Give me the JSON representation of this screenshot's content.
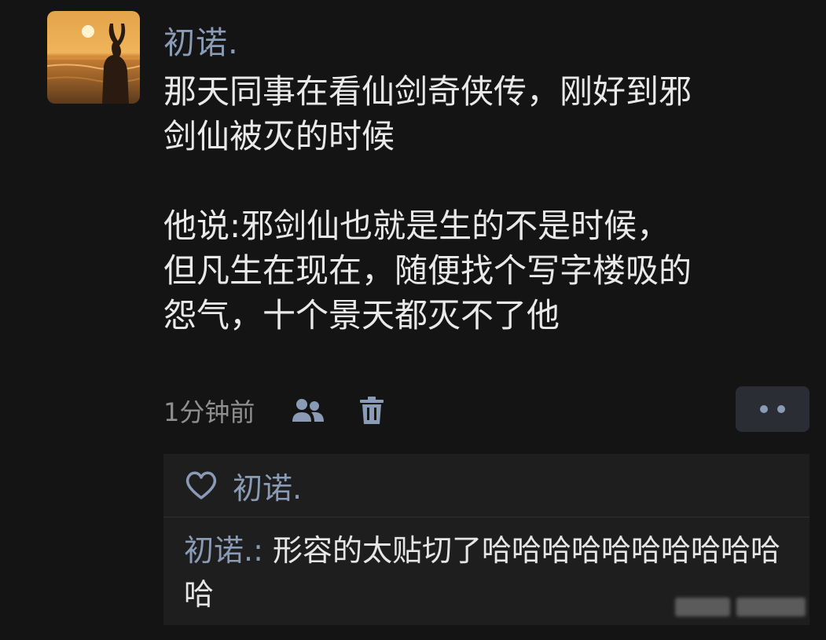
{
  "post": {
    "author": "初诺.",
    "text": "那天同事在看仙剑奇侠传，刚好到邪\n剑仙被灭的时候\n\n他说:邪剑仙也就是生的不是时候，\n但凡生在现在，随便找个写字楼吸的\n怨气，十个景天都灭不了他",
    "time": "1分钟前",
    "icons": {
      "visibility": "people-icon",
      "delete": "trash-icon",
      "more": "more-dots-icon"
    }
  },
  "comments": {
    "likes_icon": "heart-icon",
    "liker_name": "初诺.",
    "reply_author": "初诺.",
    "reply_separator": ": ",
    "reply_text": "形容的太贴切了哈哈哈哈哈哈哈哈哈哈哈"
  },
  "colors": {
    "background": "#141414",
    "name_accent": "#8a9bb6",
    "text": "#e9e9e9",
    "muted": "#8f8f8f",
    "comment_bg": "#1e1e1e"
  }
}
